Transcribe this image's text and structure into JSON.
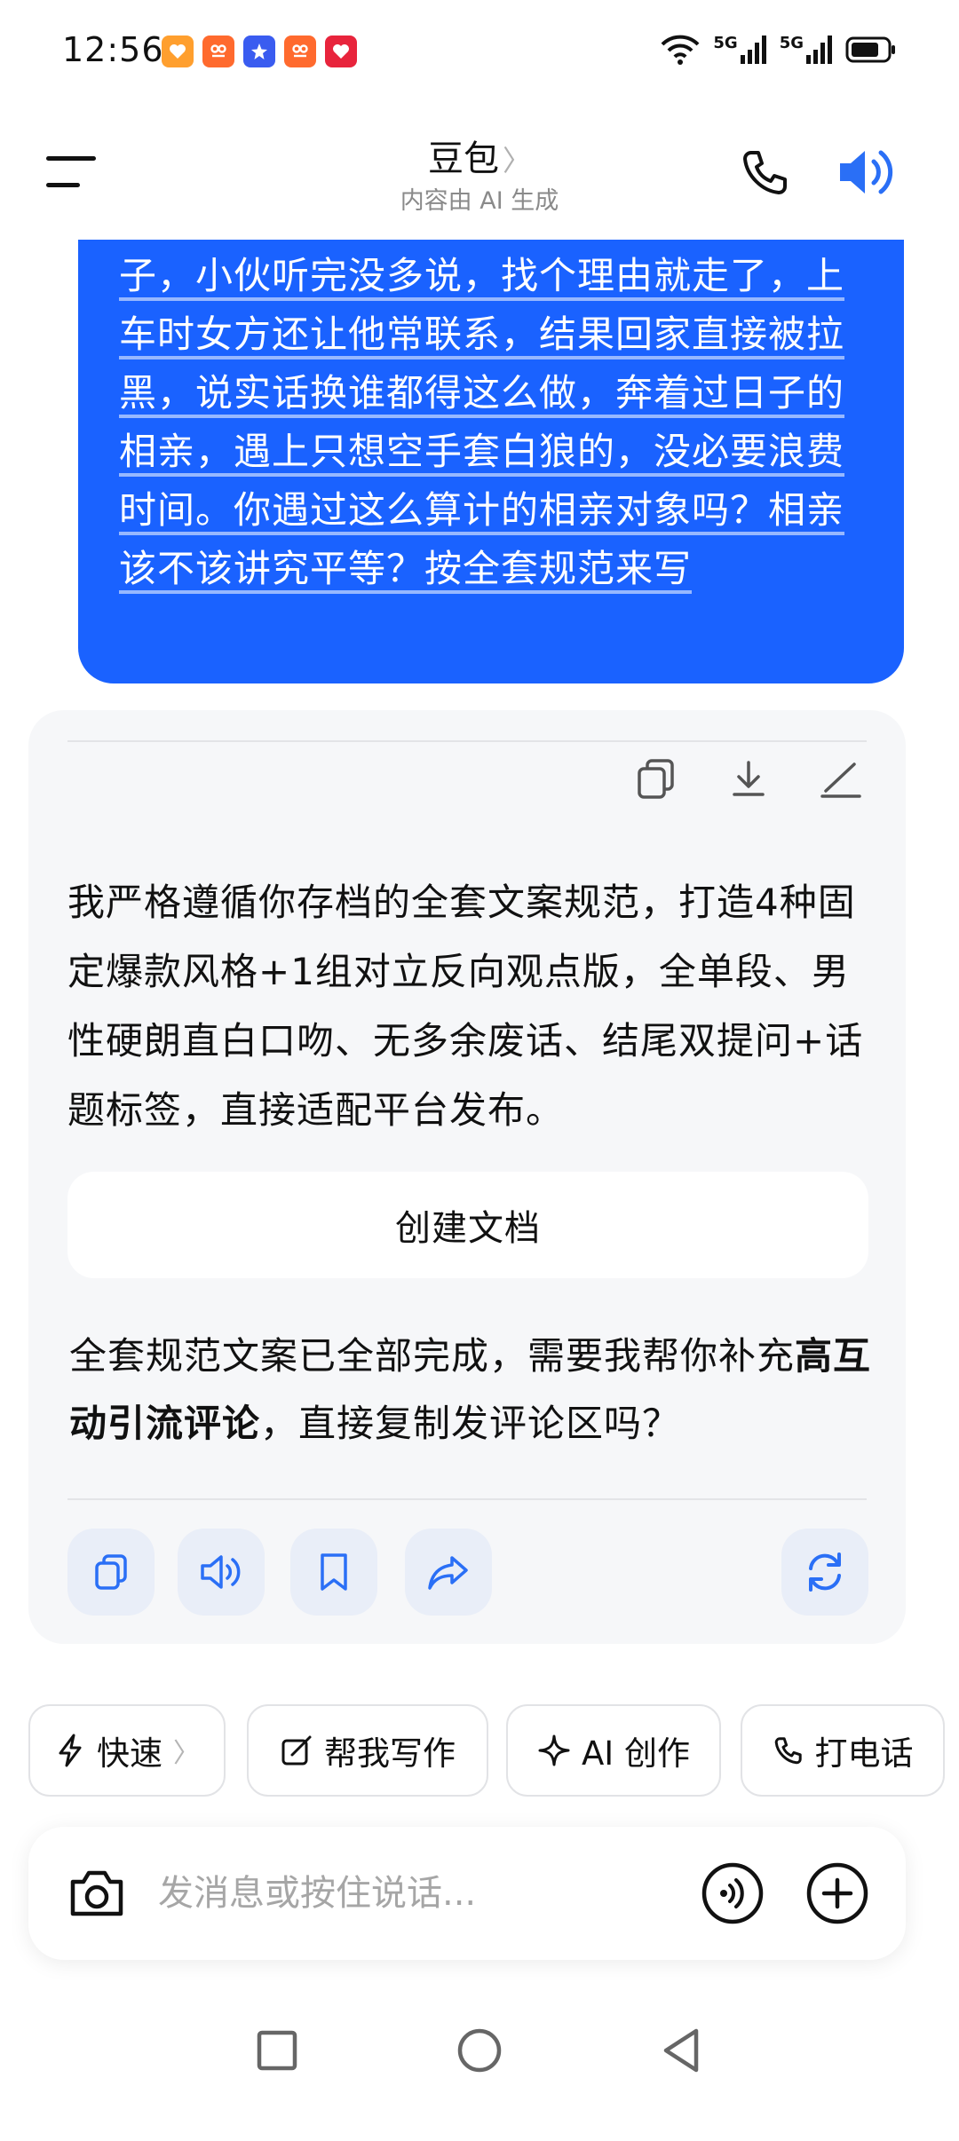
{
  "status_bar": {
    "time": "12:56",
    "signal_1": "5G",
    "signal_2": "5G"
  },
  "header": {
    "title": "豆包",
    "subtitle": "内容由 AI 生成"
  },
  "user_message": {
    "text": "子，小伙听完没多说，找个理由就走了，上车时女方还让他常联系，结果回家直接被拉黑，说实话换谁都得这么做，奔着过日子的相亲，遇上只想空手套白狼的，没必要浪费时间。你遇过这么算计的相亲对象吗？相亲该不该讲究平等？按全套规范来写"
  },
  "ai_message": {
    "paragraph": "我严格遵循你存档的全套文案规范，打造4种固定爆款风格+1组对立反向观点版，全单段、男性硬朗直白口吻、无多余废话、结尾双提问+话题标签，直接适配平台发布。",
    "create_doc_label": "创建文档",
    "follow_up_before": "全套规范文案已全部完成，需要我帮你补充",
    "follow_up_bold": "高互动引流评论",
    "follow_up_after": "，直接复制发评论区吗？"
  },
  "quick_chips": [
    {
      "label": "快速"
    },
    {
      "label": "帮我写作"
    },
    {
      "label": "AI 创作"
    },
    {
      "label": "打电话"
    }
  ],
  "input": {
    "placeholder": "发消息或按住说话..."
  },
  "colors": {
    "accent": "#1a62ff",
    "card_bg": "#f6f7f9",
    "action_bg": "#e9eef8",
    "icon_blue": "#2a6ff6"
  }
}
